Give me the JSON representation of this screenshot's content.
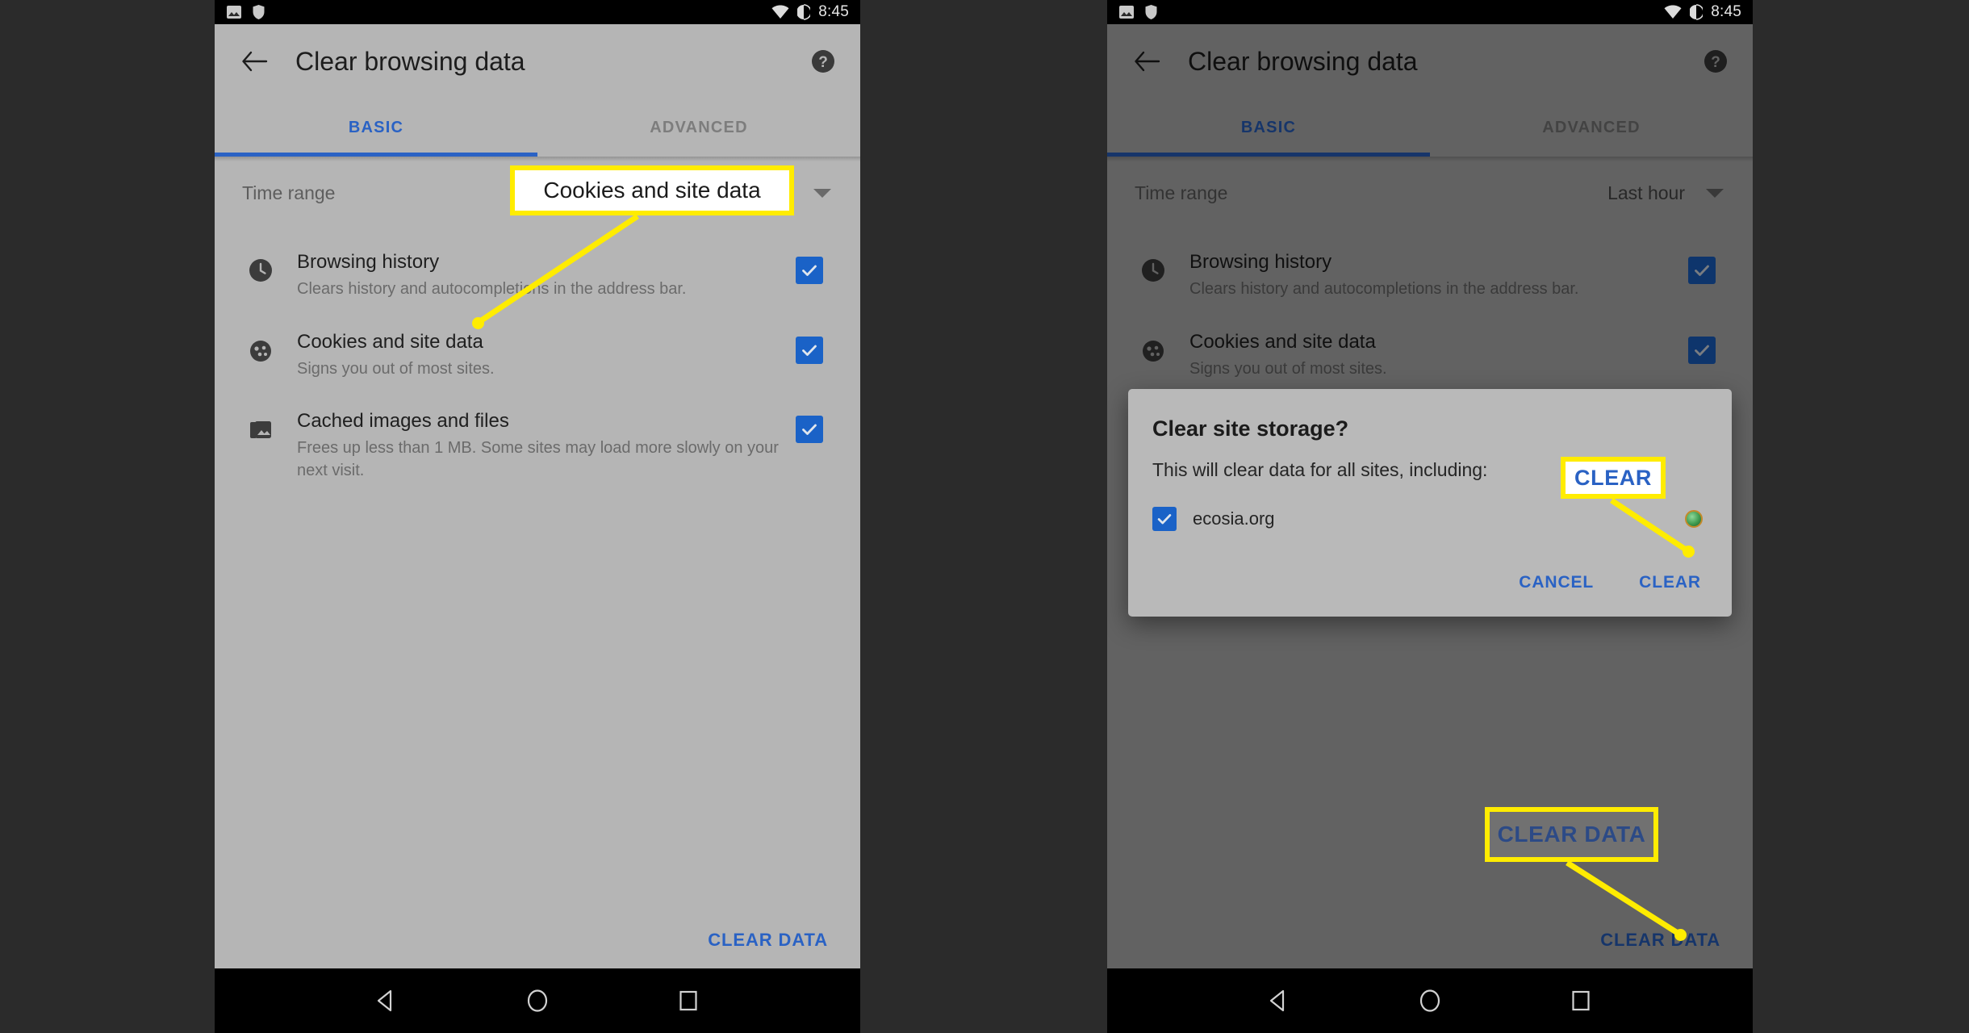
{
  "statusbar": {
    "left_icons": [
      "image-icon",
      "shield-icon"
    ],
    "right_icons": [
      "wifi-icon",
      "battery-icon"
    ],
    "time": "8:45"
  },
  "toolbar": {
    "back_icon": "back-arrow-icon",
    "title": "Clear browsing data",
    "help_icon": "help-icon"
  },
  "tabs": [
    {
      "label": "BASIC",
      "active": true
    },
    {
      "label": "ADVANCED",
      "active": false
    }
  ],
  "time_range": {
    "label": "Time range",
    "value_left": "",
    "value_right": "Last hour",
    "caret_icon": "chevron-down-icon"
  },
  "options": [
    {
      "icon": "clock-icon",
      "title": "Browsing history",
      "desc": "Clears history and autocompletions in the address bar.",
      "checked": true
    },
    {
      "icon": "cookie-icon",
      "title": "Cookies and site data",
      "desc": "Signs you out of most sites.",
      "checked": true
    },
    {
      "icon": "photo-stack-icon",
      "title": "Cached images and files",
      "desc": "Frees up less than 1 MB. Some sites may load more slowly on your next visit.",
      "checked": true
    }
  ],
  "options_right": [
    {
      "icon": "clock-icon",
      "title": "Browsing history",
      "desc": "Clears history and autocompletions in the address bar.",
      "checked": true
    },
    {
      "icon": "cookie-icon",
      "title": "Cookies and site data",
      "desc": "Signs you out of most sites.",
      "checked": true
    }
  ],
  "footer": {
    "clear_data_label": "CLEAR DATA"
  },
  "dialog": {
    "title": "Clear site storage?",
    "body": "This will clear data for all sites, including:",
    "site": "ecosia.org",
    "site_checked": true,
    "cancel_label": "CANCEL",
    "clear_label": "CLEAR",
    "favicon": "ecosia-favicon"
  },
  "navbar": {
    "back_icon": "nav-back-triangle-icon",
    "home_icon": "nav-home-circle-icon",
    "recents_icon": "nav-recents-square-icon"
  },
  "annotations": [
    {
      "id": "cookies",
      "text": "Cookies and site data",
      "style": "white"
    },
    {
      "id": "clear",
      "text": "CLEAR",
      "style": "white"
    },
    {
      "id": "cleardata",
      "text": "CLEAR DATA",
      "style": "ghost"
    }
  ],
  "colors": {
    "accent_blue": "#2a62c4",
    "checkbox_blue": "#1a62c7",
    "highlight_yellow": "#ffec00",
    "app_bg": "#b5b5b5",
    "statusbar_bg": "#000000",
    "page_bg": "#2b2b2b"
  }
}
